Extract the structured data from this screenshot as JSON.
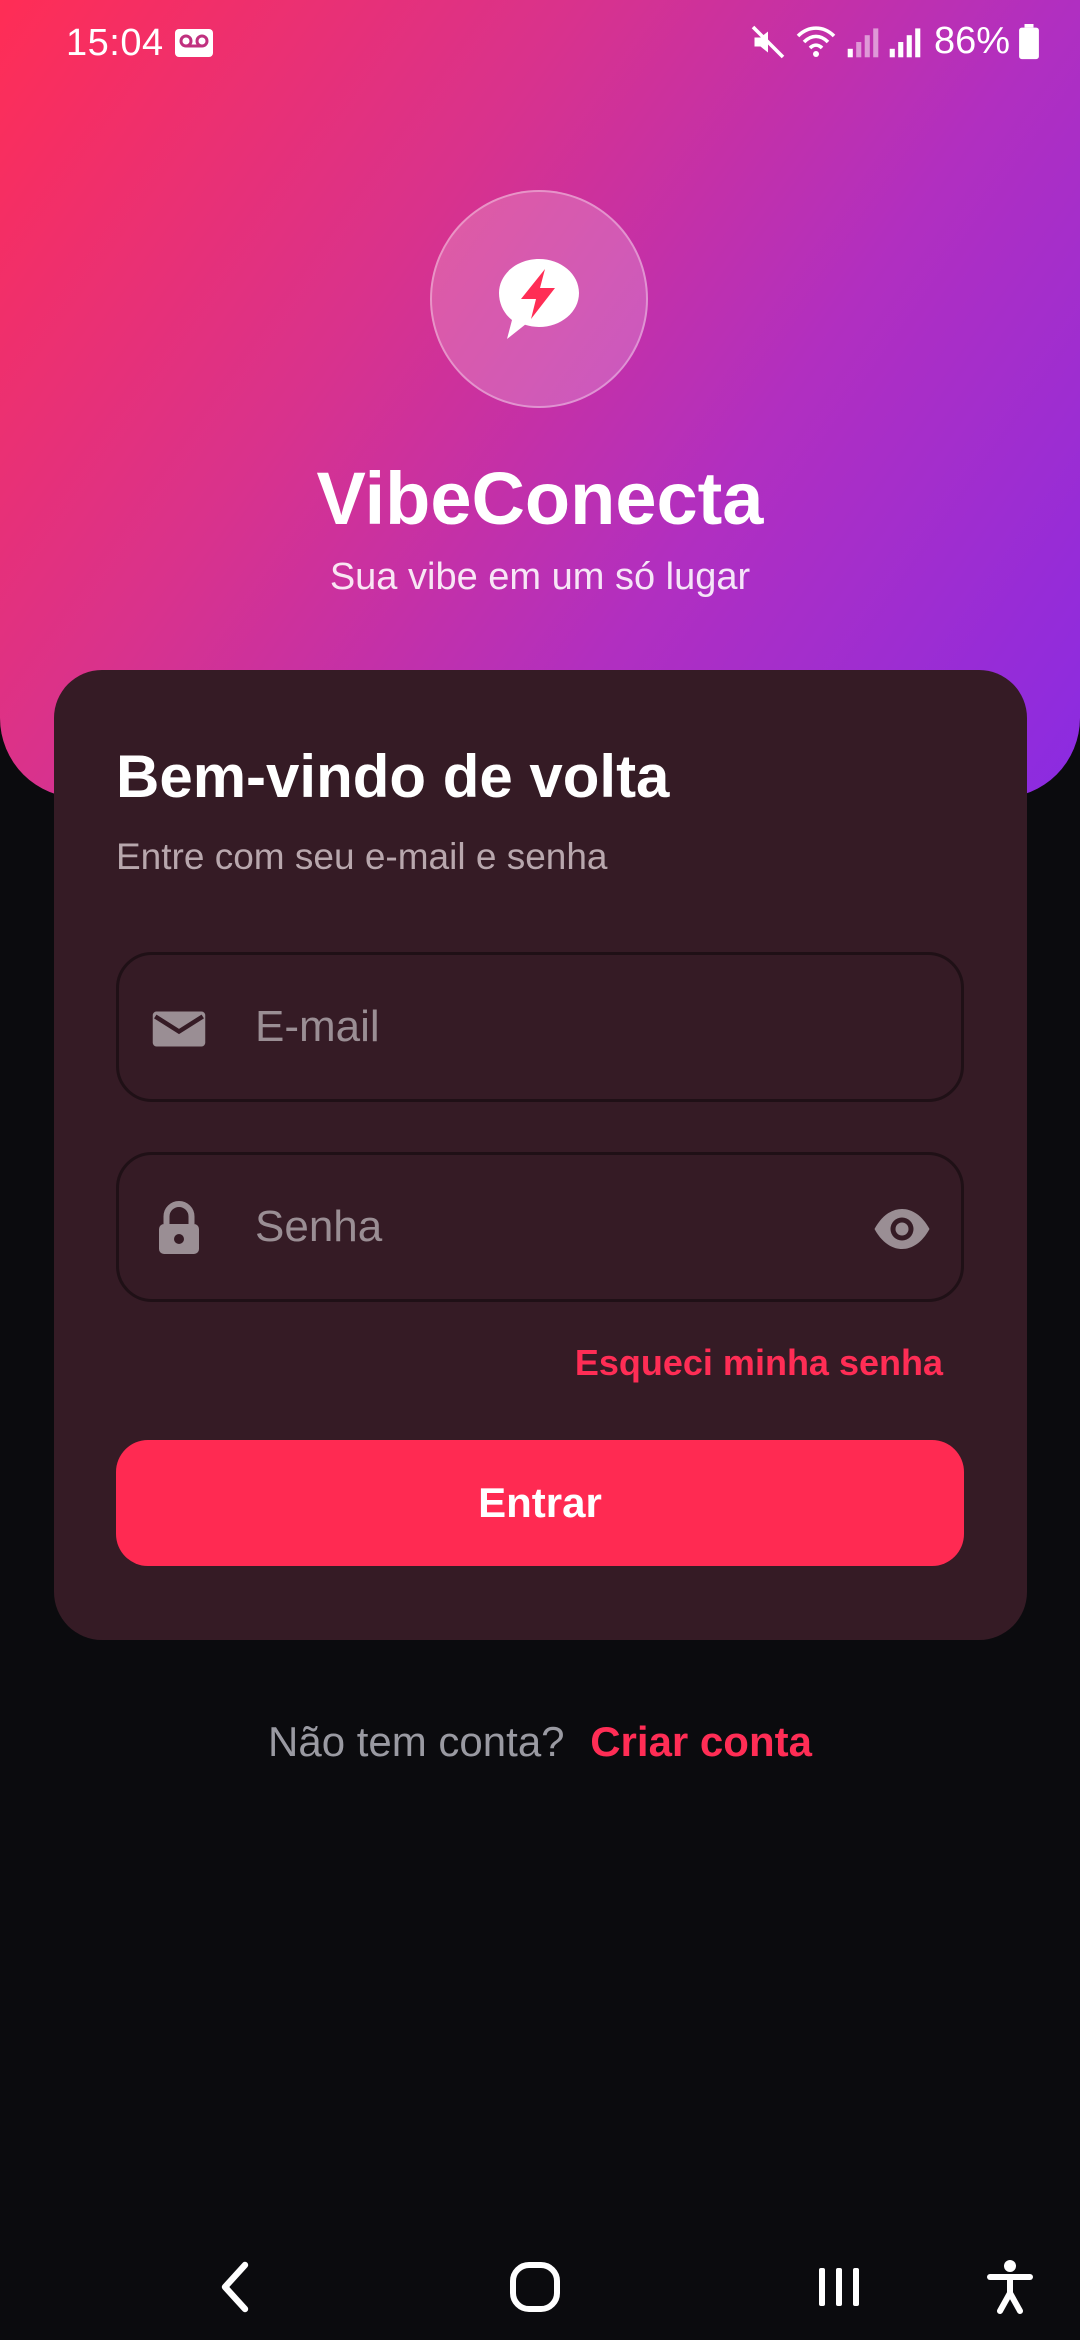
{
  "status_bar": {
    "time": "15:04",
    "battery_percent": "86%"
  },
  "app": {
    "name": "VibeConecta",
    "tagline": "Sua vibe em um só lugar",
    "logo_icon": "chat-bolt-icon"
  },
  "login_card": {
    "title": "Bem-vindo de volta",
    "subtitle": "Entre com seu e-mail e senha",
    "email_placeholder": "E-mail",
    "email_value": "",
    "password_placeholder": "Senha",
    "password_value": "",
    "forgot_password": "Esqueci minha senha",
    "submit_label": "Entrar"
  },
  "signup": {
    "prompt": "Não tem conta?",
    "link": "Criar conta"
  },
  "colors": {
    "accent": "#ff2d55",
    "card_background": "#351b25",
    "page_background": "#0b0b0e",
    "gradient_start": "#ff2d55",
    "gradient_end": "#8a2be2"
  }
}
